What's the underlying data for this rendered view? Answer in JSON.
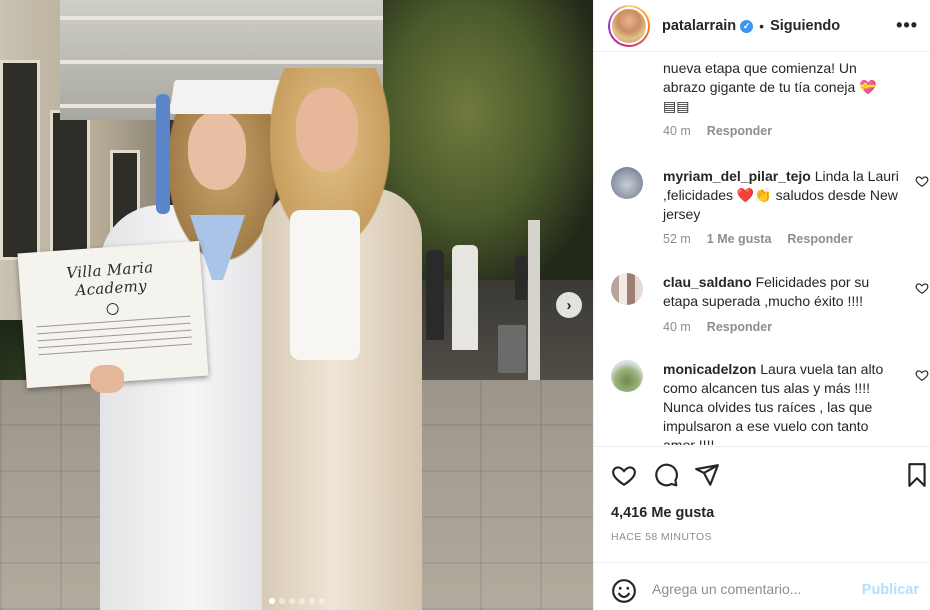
{
  "header": {
    "username": "patalarrain",
    "verified_badge": "✓",
    "separator": "•",
    "follow_status": "Siguiendo",
    "more_label": "•••"
  },
  "photo": {
    "diploma_title": "Villa Maria Academy",
    "next_arrow": "›",
    "carousel_dots": 6,
    "carousel_active_index": 0
  },
  "comments": [
    {
      "username": "",
      "text": "nueva etapa que comienza! Un abrazo gigante de tu tía coneja 💝",
      "extra": "▤▤",
      "time": "40 m",
      "likes": "",
      "reply": "Responder"
    },
    {
      "username": "myriam_del_pilar_tejo",
      "text": " Linda la Lauri ,felicidades ❤️👏 saludos desde New jersey",
      "time": "52 m",
      "likes": "1 Me gusta",
      "reply": "Responder"
    },
    {
      "username": "clau_saldano",
      "text": " Felicidades por su etapa superada ,mucho éxito !!!!",
      "time": "40 m",
      "likes": "",
      "reply": "Responder"
    },
    {
      "username": "monicadelzon",
      "text": " Laura vuela tan alto como alcancen tus alas y más !!!! Nunca olvides tus raíces , las que impulsaron a ese vuelo con tanto amor !!!!",
      "time": "",
      "likes": "",
      "reply": ""
    }
  ],
  "footer": {
    "likes_count": "4,416 Me gusta",
    "time_ago": "HACE 58 MINUTOS",
    "comment_placeholder": "Agrega un comentario...",
    "post_label": "Publicar"
  },
  "colors": {
    "link_disabled": "#b2dffc",
    "verified": "#3897f0",
    "secondary_text": "#8e8e8e"
  }
}
